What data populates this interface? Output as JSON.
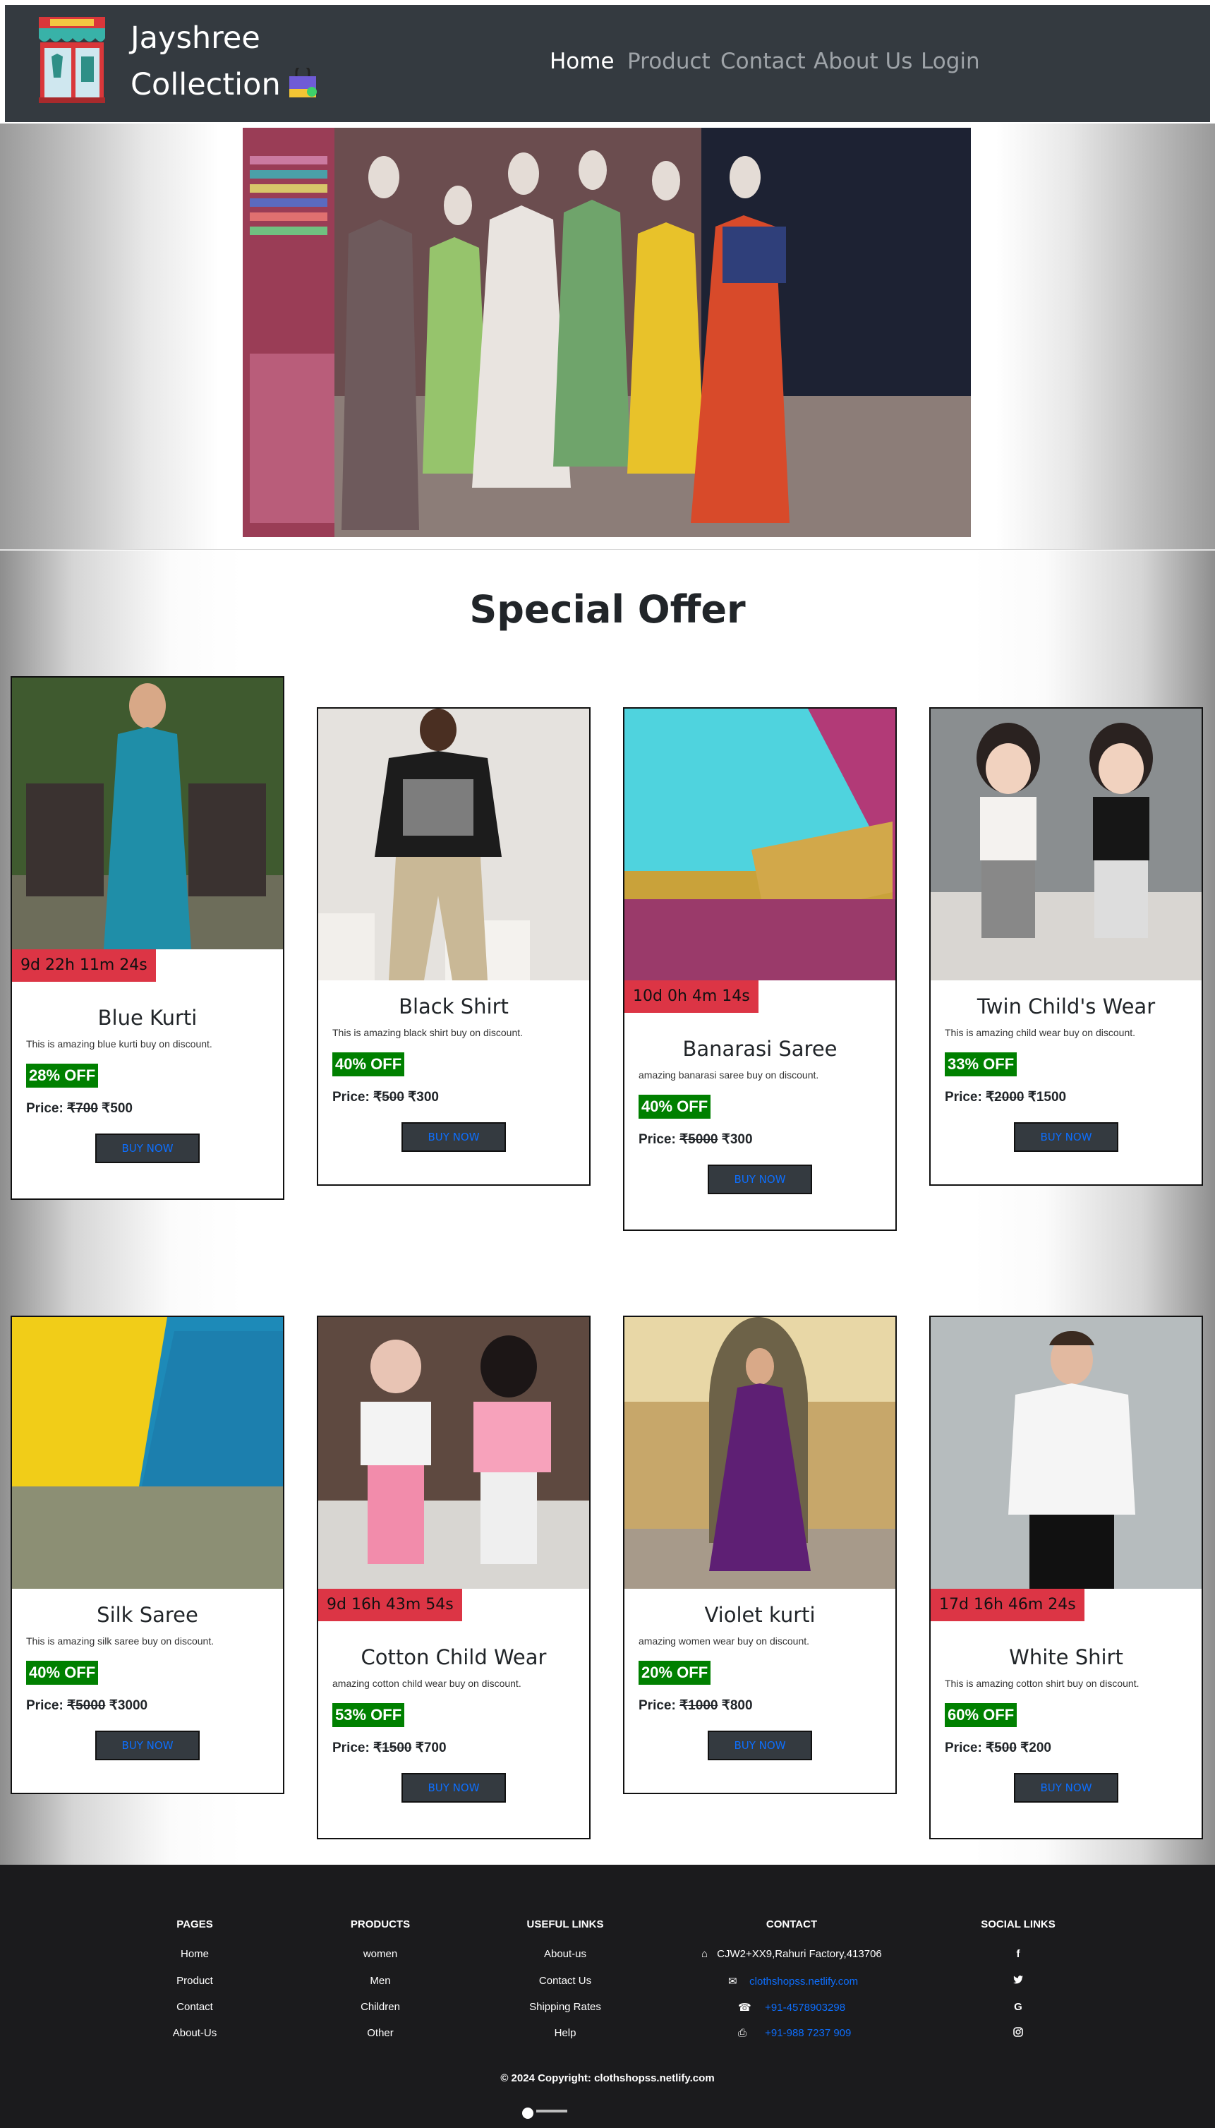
{
  "nav": {
    "brand_line1": "Jayshree",
    "brand_line2": "Collection",
    "items": [
      "Home",
      "Product",
      "Contact",
      "About Us",
      "Login"
    ]
  },
  "offer": {
    "title": "Special Offer",
    "price_label": "Price:",
    "buy_label": "BUY NOW"
  },
  "products": [
    {
      "name": "Blue Kurti",
      "timer": "9d 22h 11m 24s",
      "desc": "This is amazing blue kurti buy on discount.",
      "discount": "28% OFF",
      "old_price": "₹700",
      "new_price": "₹500"
    },
    {
      "name": "Black Shirt",
      "timer": "",
      "desc": "This is amazing black shirt buy on discount.",
      "discount": "40% OFF",
      "old_price": "₹500",
      "new_price": "₹300"
    },
    {
      "name": "Banarasi Saree",
      "timer": "10d 0h 4m 14s",
      "desc": "amazing banarasi saree buy on discount.",
      "discount": "40% OFF",
      "old_price": "₹5000",
      "new_price": "₹300"
    },
    {
      "name": "Twin Child's Wear",
      "timer": "",
      "desc": "This is amazing child wear buy on discount.",
      "discount": "33% OFF",
      "old_price": "₹2000",
      "new_price": "₹1500"
    },
    {
      "name": "Silk Saree",
      "timer": "",
      "desc": "This is amazing silk saree buy on discount.",
      "discount": "40% OFF",
      "old_price": "₹5000",
      "new_price": "₹3000"
    },
    {
      "name": "Cotton Child Wear",
      "timer": "9d 16h 43m 54s",
      "desc": "amazing cotton child wear buy on discount.",
      "discount": "53% OFF",
      "old_price": "₹1500",
      "new_price": "₹700"
    },
    {
      "name": "Violet kurti",
      "timer": "",
      "desc": "amazing women wear buy on discount.",
      "discount": "20% OFF",
      "old_price": "₹1000",
      "new_price": "₹800"
    },
    {
      "name": "White Shirt",
      "timer": "17d 16h 46m 24s",
      "desc": "This is amazing cotton shirt buy on discount.",
      "discount": "60% OFF",
      "old_price": "₹500",
      "new_price": "₹200"
    }
  ],
  "footer": {
    "pages": {
      "title": "PAGES",
      "items": [
        "Home",
        "Product",
        "Contact",
        "About-Us"
      ]
    },
    "products": {
      "title": "PRODUCTS",
      "items": [
        "women",
        "Men",
        "Children",
        "Other"
      ]
    },
    "useful": {
      "title": "USEFUL LINKS",
      "items": [
        "About-us",
        "Contact Us",
        "Shipping Rates",
        "Help"
      ]
    },
    "contact": {
      "title": "CONTACT",
      "address": "CJW2+XX9,Rahuri Factory,413706",
      "website": "clothshopss.netlify.com",
      "phone": "+91-4578903298",
      "fax": "+91-988 7237 909"
    },
    "social": {
      "title": "SOCIAL LINKS",
      "icons": [
        "facebook-icon",
        "twitter-icon",
        "google-icon",
        "instagram-icon"
      ]
    },
    "copyright": "© 2024 Copyright: clothshopss.netlify.com"
  }
}
